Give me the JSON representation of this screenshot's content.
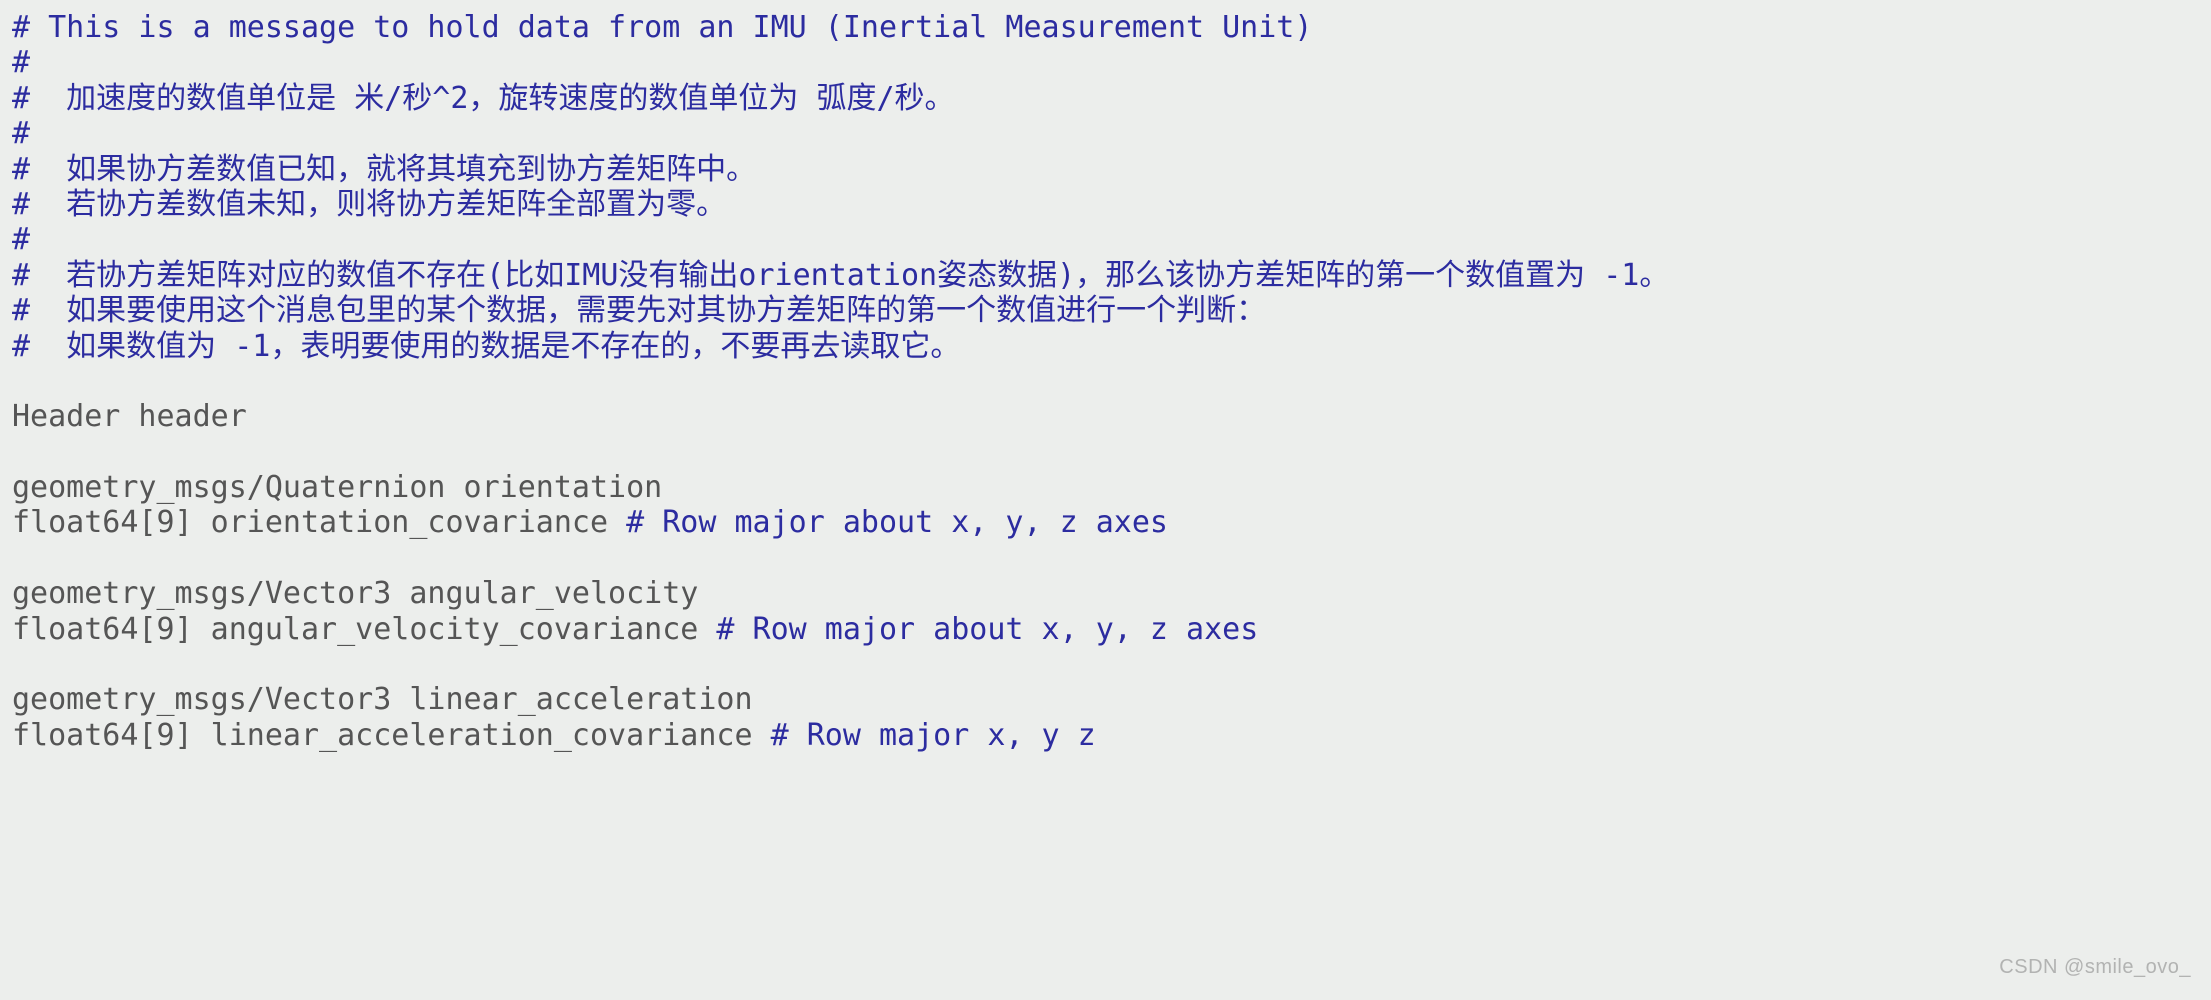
{
  "lines": [
    {
      "spans": [
        {
          "cls": "comment",
          "text": "# This is a message to hold data from an IMU (Inertial Measurement Unit)"
        }
      ]
    },
    {
      "spans": [
        {
          "cls": "comment",
          "text": "#"
        }
      ]
    },
    {
      "spans": [
        {
          "cls": "comment",
          "text": "#  加速度的数值单位是 米/秒^2，旋转速度的数值单位为 弧度/秒。"
        }
      ]
    },
    {
      "spans": [
        {
          "cls": "comment",
          "text": "#"
        }
      ]
    },
    {
      "spans": [
        {
          "cls": "comment",
          "text": "#  如果协方差数值已知，就将其填充到协方差矩阵中。"
        }
      ]
    },
    {
      "spans": [
        {
          "cls": "comment",
          "text": "#  若协方差数值未知，则将协方差矩阵全部置为零。"
        }
      ]
    },
    {
      "spans": [
        {
          "cls": "comment",
          "text": "#"
        }
      ]
    },
    {
      "spans": [
        {
          "cls": "comment",
          "text": "#  若协方差矩阵对应的数值不存在(比如IMU没有输出orientation姿态数据)，那么该协方差矩阵的第一个数值置为 -1。"
        }
      ]
    },
    {
      "spans": [
        {
          "cls": "comment",
          "text": "#  如果要使用这个消息包里的某个数据，需要先对其协方差矩阵的第一个数值进行一个判断："
        }
      ]
    },
    {
      "spans": [
        {
          "cls": "comment",
          "text": "#  如果数值为 -1，表明要使用的数据是不存在的，不要再去读取它。"
        }
      ]
    },
    {
      "spans": [
        {
          "cls": "plain",
          "text": ""
        }
      ]
    },
    {
      "spans": [
        {
          "cls": "plain",
          "text": "Header header"
        }
      ]
    },
    {
      "spans": [
        {
          "cls": "plain",
          "text": ""
        }
      ]
    },
    {
      "spans": [
        {
          "cls": "plain",
          "text": "geometry_msgs/Quaternion orientation"
        }
      ]
    },
    {
      "spans": [
        {
          "cls": "plain",
          "text": "float64[9] orientation_covariance "
        },
        {
          "cls": "comment",
          "text": "# Row major about x, y, z axes"
        }
      ]
    },
    {
      "spans": [
        {
          "cls": "plain",
          "text": ""
        }
      ]
    },
    {
      "spans": [
        {
          "cls": "plain",
          "text": "geometry_msgs/Vector3 angular_velocity"
        }
      ]
    },
    {
      "spans": [
        {
          "cls": "plain",
          "text": "float64[9] angular_velocity_covariance "
        },
        {
          "cls": "comment",
          "text": "# Row major about x, y, z axes"
        }
      ]
    },
    {
      "spans": [
        {
          "cls": "plain",
          "text": ""
        }
      ]
    },
    {
      "spans": [
        {
          "cls": "plain",
          "text": "geometry_msgs/Vector3 linear_acceleration"
        }
      ]
    },
    {
      "spans": [
        {
          "cls": "plain",
          "text": "float64[9] linear_acceleration_covariance "
        },
        {
          "cls": "comment",
          "text": "# Row major x, y z"
        }
      ]
    }
  ],
  "watermark": "CSDN @smile_ovo_"
}
